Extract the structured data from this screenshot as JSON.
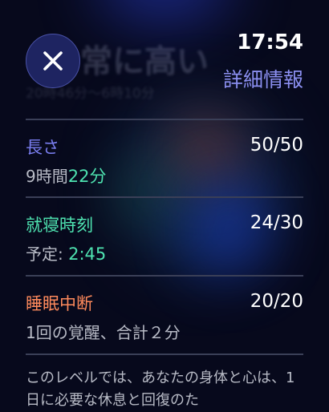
{
  "header": {
    "time": "17:54",
    "detail_link": "詳細情報",
    "background_title": "常に高い",
    "background_subtitle": "20時46分～6時10分"
  },
  "close_button": {
    "icon": "close-icon"
  },
  "sections": [
    {
      "label": "長さ",
      "score": "50/50",
      "sub_prefix": "9時間",
      "sub_highlight": "22分",
      "label_color": "#7a7ef0",
      "highlight_color": "#4ee2b0"
    },
    {
      "label": "就寝時刻",
      "score": "24/30",
      "sub_prefix": "予定: ",
      "sub_highlight": "2:45",
      "label_color": "#4ee2b0",
      "highlight_color": "#4ee2b0"
    },
    {
      "label": "睡眠中断",
      "score": "20/20",
      "sub_text": "1回の覚醒、合計２分",
      "label_color": "#ff8a5c"
    }
  ],
  "description": "このレベルでは、あなたの身体と心は、1日に必要な休息と回復のた"
}
